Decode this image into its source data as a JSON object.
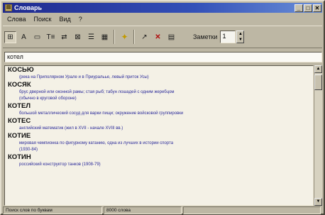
{
  "window": {
    "title": "Словарь",
    "app_icon": "book-icon",
    "buttons": {
      "minimize": "_",
      "maximize": "□",
      "close": "✕"
    }
  },
  "menu": [
    "Слова",
    "Поиск",
    "Вид",
    "?"
  ],
  "toolbar": {
    "tools": [
      {
        "name": "book-view-icon",
        "glyph": "⊞",
        "pressed": true
      },
      {
        "name": "font-icon",
        "glyph": "A",
        "pressed": false
      },
      {
        "name": "frame-icon",
        "glyph": "▭",
        "pressed": false
      },
      {
        "name": "text-icon",
        "glyph": "Т≡",
        "pressed": false
      },
      {
        "name": "switch-icon",
        "glyph": "⇄",
        "pressed": false
      },
      {
        "name": "grid-icon",
        "glyph": "⊠",
        "pressed": false
      },
      {
        "name": "list-icon",
        "glyph": "☰",
        "pressed": false
      },
      {
        "name": "table-icon",
        "glyph": "▦",
        "pressed": false
      },
      {
        "name": "bulb-icon",
        "glyph": "💡",
        "pressed": false
      },
      {
        "name": "pointer-icon",
        "glyph": "↗",
        "pressed": false
      },
      {
        "name": "delete-icon",
        "glyph": "✕",
        "pressed": false
      },
      {
        "name": "window-icon",
        "glyph": "▤",
        "pressed": false
      }
    ],
    "frame_label": "Заметки",
    "frame_value": "1"
  },
  "search": {
    "value": "котел"
  },
  "entries": [
    {
      "word": "КОСЬЮ",
      "definitions": [
        "(река на Приполярном Урале и в Приуральье, левый приток Усы)"
      ]
    },
    {
      "word": "КОСЯК",
      "definitions": [
        "брус дверной или оконной рамы; стая рыб; табун лошадей с одним жеребцом",
        "(обычно в круговой обороне)"
      ]
    },
    {
      "word": "КОТЕЛ",
      "definitions": [
        "большой металлический сосуд для варки пищи; окружение войсковой группировки"
      ]
    },
    {
      "word": "КОТЕС",
      "definitions": [
        "английский математик (жил в XVII - начале XVIII вв.)"
      ]
    },
    {
      "word": "КОТИЕ",
      "definitions": [
        "мировая чемпионка по фигурному катанию, одна из лучших в истории спорта",
        "(1930-84)"
      ]
    },
    {
      "word": "КОТИН",
      "definitions": [
        "российский конструктор танков (1908-79)"
      ]
    }
  ],
  "status": {
    "left": "Поиск слов по буквам",
    "count": "8000 слова"
  }
}
